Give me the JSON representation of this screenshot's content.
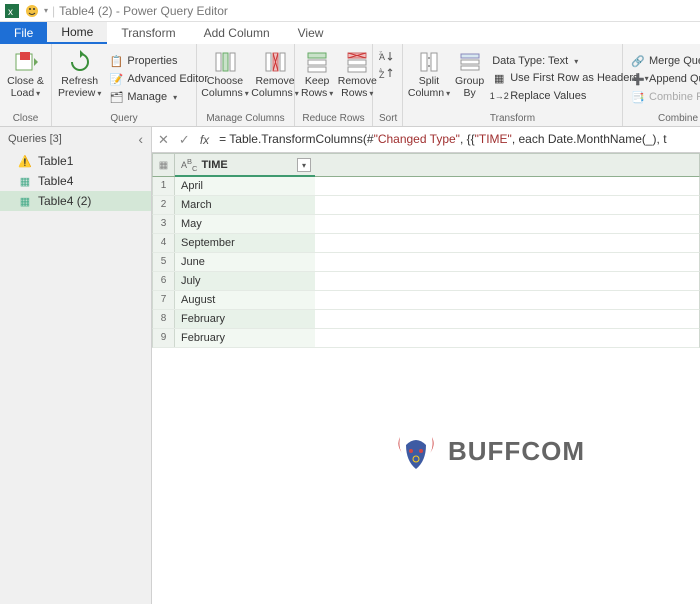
{
  "title": "Table4 (2) - Power Query Editor",
  "tabs": {
    "file": "File",
    "home": "Home",
    "transform": "Transform",
    "add": "Add Column",
    "view": "View"
  },
  "ribbon": {
    "close": {
      "label": "Close &\nLoad",
      "group": "Close"
    },
    "query": {
      "refresh": "Refresh\nPreview",
      "properties": "Properties",
      "advanced": "Advanced Editor",
      "manage": "Manage",
      "group": "Query"
    },
    "cols": {
      "choose": "Choose\nColumns",
      "remove": "Remove\nColumns",
      "group": "Manage Columns"
    },
    "rows": {
      "keep": "Keep\nRows",
      "remove": "Remove\nRows",
      "group": "Reduce Rows"
    },
    "sort": {
      "group": "Sort"
    },
    "split": "Split\nColumn",
    "groupby": "Group\nBy",
    "transform": {
      "datatype": "Data Type: Text",
      "firstrow": "Use First Row as Headers",
      "replace": "Replace Values",
      "group": "Transform"
    },
    "combine": {
      "merge": "Merge Queries",
      "append": "Append Queries",
      "combinefiles": "Combine Files",
      "group": "Combine"
    }
  },
  "sidebar": {
    "header": "Queries [3]",
    "items": [
      {
        "label": "Table1",
        "warn": true
      },
      {
        "label": "Table4",
        "warn": false
      },
      {
        "label": "Table4 (2)",
        "warn": false,
        "selected": true
      }
    ]
  },
  "formula": {
    "prefix": "= Table.TransformColumns(#",
    "str1": "\"Changed Type\"",
    "mid": ", {{",
    "str2": "\"TIME\"",
    "suffix": ", each Date.MonthName(_), t"
  },
  "grid": {
    "column": "TIME",
    "rows": [
      "April",
      "March",
      "May",
      "September",
      "June",
      "July",
      "August",
      "February",
      "February"
    ]
  },
  "watermark": "BUFFCOM"
}
